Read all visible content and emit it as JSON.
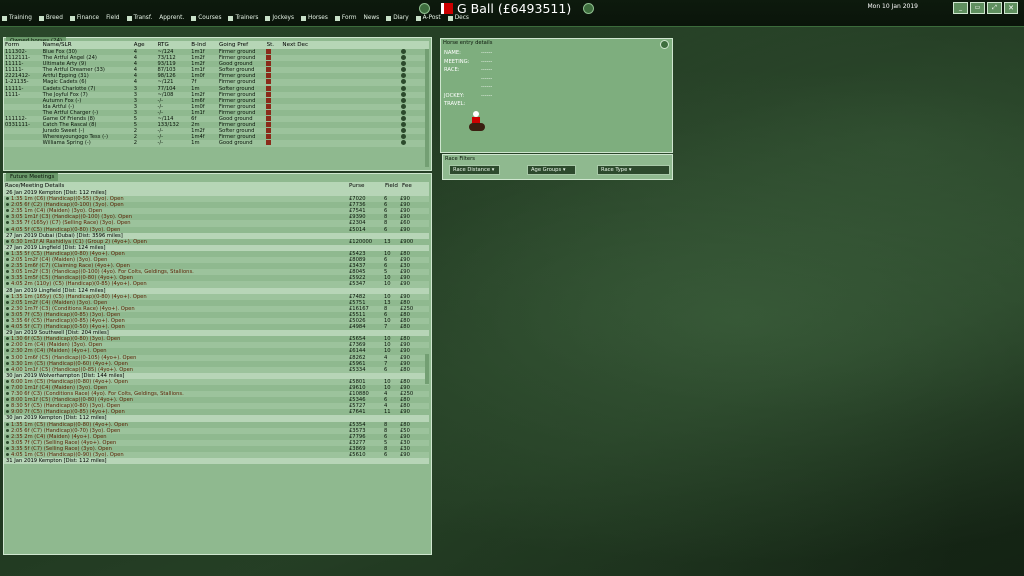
{
  "title": "G Ball  (£6493511)",
  "date": "Mon 10 Jan 2019",
  "window_buttons": [
    "_",
    "▭",
    "⤢"
  ],
  "menu": [
    {
      "label": "Training",
      "icon": "whistle-icon"
    },
    {
      "label": "Breed",
      "icon": "horse-icon"
    },
    {
      "label": "Finance",
      "icon": "coins-icon"
    },
    {
      "label": "Field",
      "icon": ""
    },
    {
      "label": "Transf.",
      "icon": "transfer-icon"
    },
    {
      "label": "Apprent.",
      "icon": ""
    },
    {
      "label": "Courses",
      "icon": "flag-icon"
    },
    {
      "label": "Trainers",
      "icon": "person-icon"
    },
    {
      "label": "Jockeys",
      "icon": "person-icon"
    },
    {
      "label": "Horses",
      "icon": "horse-icon"
    },
    {
      "label": "Form",
      "icon": "chart-icon"
    },
    {
      "label": "News",
      "icon": ""
    },
    {
      "label": "Diary",
      "icon": "book-icon"
    },
    {
      "label": "A-Post",
      "icon": "post-icon"
    },
    {
      "label": "Decs",
      "icon": "doc-icon"
    }
  ],
  "owned": {
    "tab": "Owned horses (24)",
    "headers": [
      "Form",
      "Name/SLR",
      "Age",
      "RTG",
      "B-Ind",
      "Going Pref",
      "St.",
      "Next Dec"
    ],
    "rows": [
      [
        "111302-",
        "Blue Fox (30)",
        "4",
        "~/124",
        "1m1f",
        "Firmer ground"
      ],
      [
        "1112111-",
        "The Artful Angel (24)",
        "4",
        "73/112",
        "1m2f",
        "Firmer ground"
      ],
      [
        "11111-",
        "Ultimate Arty (9)",
        "4",
        "93/119",
        "1m2f",
        "Good ground"
      ],
      [
        "11111-",
        "The Artful Dreamer (33)",
        "4",
        "87/103",
        "1m1f",
        "Softer ground"
      ],
      [
        "2221412-",
        "Artful Epping (31)",
        "4",
        "98/126",
        "1m0f",
        "Firmer ground"
      ],
      [
        "1-21135-",
        "Magic Cadets (6)",
        "4",
        "~/121",
        "7f",
        "Firmer ground"
      ],
      [
        "11111-",
        "Cadets Charlotte (7)",
        "3",
        "77/104",
        "1m",
        "Softer ground"
      ],
      [
        "1111-",
        "The Joyful Fox (7)",
        "3",
        "~/108",
        "1m2f",
        "Firmer ground"
      ],
      [
        "",
        "Autumn Fox (-)",
        "3",
        "-/-",
        "1m6f",
        "Firmer ground"
      ],
      [
        "",
        "Ida Artful (-)",
        "3",
        "-/-",
        "1m0f",
        "Firmer ground"
      ],
      [
        "",
        "The Artful Charger (-)",
        "3",
        "-/-",
        "1m1f",
        "Firmer ground"
      ],
      [
        "111112-",
        "Game Of Friends (8)",
        "5",
        "~/114",
        "6f",
        "Good ground"
      ],
      [
        "0331111-",
        "Catch The Rascal (8)",
        "5",
        "133/132",
        "2m",
        "Firmer ground"
      ],
      [
        "",
        "Jurado Sweet (-)",
        "2",
        "-/-",
        "1m2f",
        "Softer ground"
      ],
      [
        "",
        "Wheresyoungogo Tess (-)",
        "2",
        "-/-",
        "1m4f",
        "Firmer ground"
      ],
      [
        "",
        "Williama Spring (-)",
        "2",
        "-/-",
        "1m",
        "Good ground"
      ]
    ]
  },
  "future": {
    "tab": "Future Meetings",
    "headers": [
      "Race/Meeting Details",
      "Purse",
      "Field",
      "Fee"
    ],
    "rows": [
      {
        "meeting": "26 Jan 2019    Kempton     [Dist: 112 miles]"
      },
      {
        "race": "1:35  1m (C6) (Handicap)(0-55) (3yo).  Open",
        "purse": "£7020",
        "field": "6",
        "fee": "£90"
      },
      {
        "race": "2:05  6f (C2) (Handicap)(0-100) (3yo).  Open",
        "purse": "£7736",
        "field": "6",
        "fee": "£90"
      },
      {
        "race": "2:35  1m (C4) (Maiden) (3yo).  Open",
        "purse": "£7541",
        "field": "6",
        "fee": "£90"
      },
      {
        "race": "3:05  1m1f (C3) (Handicap)(0-100) (3yo).  Open",
        "purse": "£9390",
        "field": "8",
        "fee": "£90"
      },
      {
        "race": "3:35  7f (165y) (C7) (Selling Race) (3yo).  Open",
        "purse": "£2304",
        "field": "8",
        "fee": "£60"
      },
      {
        "race": "4:05  5f (C5) (Handicap)(0-80) (3yo).  Open",
        "purse": "£5014",
        "field": "6",
        "fee": "£90"
      },
      {
        "meeting": "27 Jan 2019    Dubai (Dubai)    [Dist: 3596 miles]"
      },
      {
        "race": "6:30  1m1f Al Rashidiya (C1) (Group 2) (4yo+).  Open",
        "purse": "£120000",
        "field": "13",
        "fee": "£900"
      },
      {
        "meeting": "27 Jan 2019    Lingfield    [Dist: 124 miles]"
      },
      {
        "race": "1:35  5f (C5) (Handicap)(0-80) (4yo+).  Open",
        "purse": "£5423",
        "field": "10",
        "fee": "£80"
      },
      {
        "race": "2:05  1m2f (C4) (Maiden) (3yo).  Open",
        "purse": "£8089",
        "field": "6",
        "fee": "£90"
      },
      {
        "race": "2:35  1m6f (C7) (Claiming Race) (4yo+).  Open",
        "purse": "£3437",
        "field": "6",
        "fee": "£30"
      },
      {
        "race": "3:05  1m2f (C3) (Handicap)(0-100) (4yo).  For Colts, Geldings, Stallions.",
        "purse": "£8045",
        "field": "5",
        "fee": "£90"
      },
      {
        "race": "3:35  1m5f (C5) (Handicap)(0-80) (4yo+).  Open",
        "purse": "£5922",
        "field": "10",
        "fee": "£90"
      },
      {
        "race": "4:05  2m (110y) (C5) (Handicap)(0-85) (4yo+).  Open",
        "purse": "£5347",
        "field": "10",
        "fee": "£90"
      },
      {
        "meeting": "28 Jan 2019    Lingfield    [Dist: 124 miles]"
      },
      {
        "race": "1:35  1m (165y) (C5) (Handicap)(0-80) (4yo+).  Open",
        "purse": "£7482",
        "field": "10",
        "fee": "£90"
      },
      {
        "race": "2:05  1m2f (C4) (Maiden) (3yo).  Open",
        "purse": "£5751",
        "field": "13",
        "fee": "£80"
      },
      {
        "race": "2:30  1m7f (C3) (Conditions Race) (4yo+).  Open",
        "purse": "£16167",
        "field": "8",
        "fee": "£250"
      },
      {
        "race": "3:05  7f (C5) (Handicap)(0-85) (3yo).  Open",
        "purse": "£5511",
        "field": "6",
        "fee": "£80"
      },
      {
        "race": "3:35  6f (C5) (Handicap)(0-85) (4yo+).  Open",
        "purse": "£5026",
        "field": "10",
        "fee": "£80"
      },
      {
        "race": "4:05  5f (C7) (Handicap)(0-50) (4yo+).  Open",
        "purse": "£4984",
        "field": "7",
        "fee": "£80"
      },
      {
        "meeting": "29 Jan 2019    Southwell    [Dist: 204 miles]"
      },
      {
        "race": "1:30  6f (C5) (Handicap)(0-80) (3yo).  Open",
        "purse": "£5654",
        "field": "10",
        "fee": "£80"
      },
      {
        "race": "2:00  1m (C4) (Maiden) (3yo).  Open",
        "purse": "£7369",
        "field": "10",
        "fee": "£90"
      },
      {
        "race": "2:30  2m (C4) (Maiden) (4yo+).  Open",
        "purse": "£6144",
        "field": "10",
        "fee": "£90"
      },
      {
        "race": "3:00  1m6f (C5) (Handicap)(0-105) (4yo+).  Open",
        "purse": "£8262",
        "field": "4",
        "fee": "£90"
      },
      {
        "race": "3:30  1m (C5) (Handicap)(0-60) (4yo+).  Open",
        "purse": "£5961",
        "field": "7",
        "fee": "£90"
      },
      {
        "race": "4:00  1m1f (C5) (Handicap)(0-85) (4yo+).  Open",
        "purse": "£5334",
        "field": "6",
        "fee": "£80"
      },
      {
        "meeting": "30 Jan 2019    Wolverhampton    [Dist: 144 miles]"
      },
      {
        "race": "6:00  1m (C5) (Handicap)(0-80) (4yo+).  Open",
        "purse": "£5801",
        "field": "10",
        "fee": "£80"
      },
      {
        "race": "7:00  1m1f (C4) (Maiden) (3yo).  Open",
        "purse": "£9610",
        "field": "10",
        "fee": "£90"
      },
      {
        "race": "7:30  6f (C3) (Conditions Race) (4yo).  For Colts, Geldings, Stallions.",
        "purse": "£10880",
        "field": "4",
        "fee": "£250"
      },
      {
        "race": "8:00  1m1f (C5) (Handicap)(0-80) (4yo+).  Open",
        "purse": "£5346",
        "field": "6",
        "fee": "£80"
      },
      {
        "race": "8:30  5f (C5) (Handicap)(0-80) (3yo).  Open",
        "purse": "£5727",
        "field": "4",
        "fee": "£80"
      },
      {
        "race": "9:00  7f (C5) (Handicap)(0-85) (4yo+).  Open",
        "purse": "£7641",
        "field": "11",
        "fee": "£90"
      },
      {
        "meeting": "30 Jan 2019    Kempton     [Dist: 112 miles]"
      },
      {
        "race": "1:35  1m (C5) (Handicap)(0-80) (4yo+).  Open",
        "purse": "£5354",
        "field": "8",
        "fee": "£80"
      },
      {
        "race": "2:05  6f (C7) (Handicap)(0-70) (3yo).  Open",
        "purse": "£3573",
        "field": "8",
        "fee": "£50"
      },
      {
        "race": "2:35  2m (C4) (Maiden) (4yo+).  Open",
        "purse": "£7796",
        "field": "6",
        "fee": "£90"
      },
      {
        "race": "3:05  7f (C7) (Selling Race) (4yo+).  Open",
        "purse": "£3277",
        "field": "5",
        "fee": "£30"
      },
      {
        "race": "3:35  5f (C7) (Selling Race) (3yo).  Open",
        "purse": "£3869",
        "field": "8",
        "fee": "£30"
      },
      {
        "race": "4:05  1m (C5) (Handicap)(0-90) (3yo).  Open",
        "purse": "£5610",
        "field": "6",
        "fee": "£90"
      },
      {
        "meeting": "31 Jan 2019    Kempton     [Dist: 112 miles]"
      }
    ]
  },
  "entry": {
    "tab": "Horse entry details",
    "labels": [
      "NAME:",
      "MEETING:",
      "RACE:",
      "",
      "",
      "JOCKEY:",
      "TRAVEL:"
    ],
    "values": [
      "------",
      "------",
      "------",
      "------",
      "------",
      "------",
      ""
    ]
  },
  "filters": {
    "tab": "Race Filters",
    "options": [
      "Race Distance",
      "Age Groups",
      "Race Type"
    ]
  }
}
